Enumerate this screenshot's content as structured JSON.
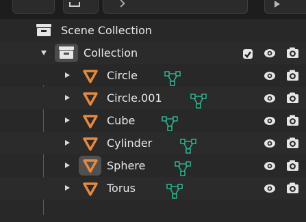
{
  "outliner": {
    "scene_collection": {
      "label": "Scene Collection"
    },
    "collection": {
      "label": "Collection",
      "checked": true
    },
    "objects": [
      {
        "label": "Circle",
        "type": "mesh"
      },
      {
        "label": "Circle.001",
        "type": "mesh"
      },
      {
        "label": "Cube",
        "type": "mesh"
      },
      {
        "label": "Cylinder",
        "type": "mesh"
      },
      {
        "label": "Sphere",
        "type": "mesh",
        "active": true
      },
      {
        "label": "Torus",
        "type": "mesh"
      }
    ]
  },
  "icons": {
    "object": "mesh-object-icon",
    "data": "mesh-data-icon",
    "visibility": "eye-icon",
    "render": "camera-icon",
    "collection": "collection-icon"
  },
  "colors": {
    "background": "#282828",
    "object_icon": "#e8883a",
    "mesh_data": "#27b38f",
    "text": "#e6e6e6"
  }
}
